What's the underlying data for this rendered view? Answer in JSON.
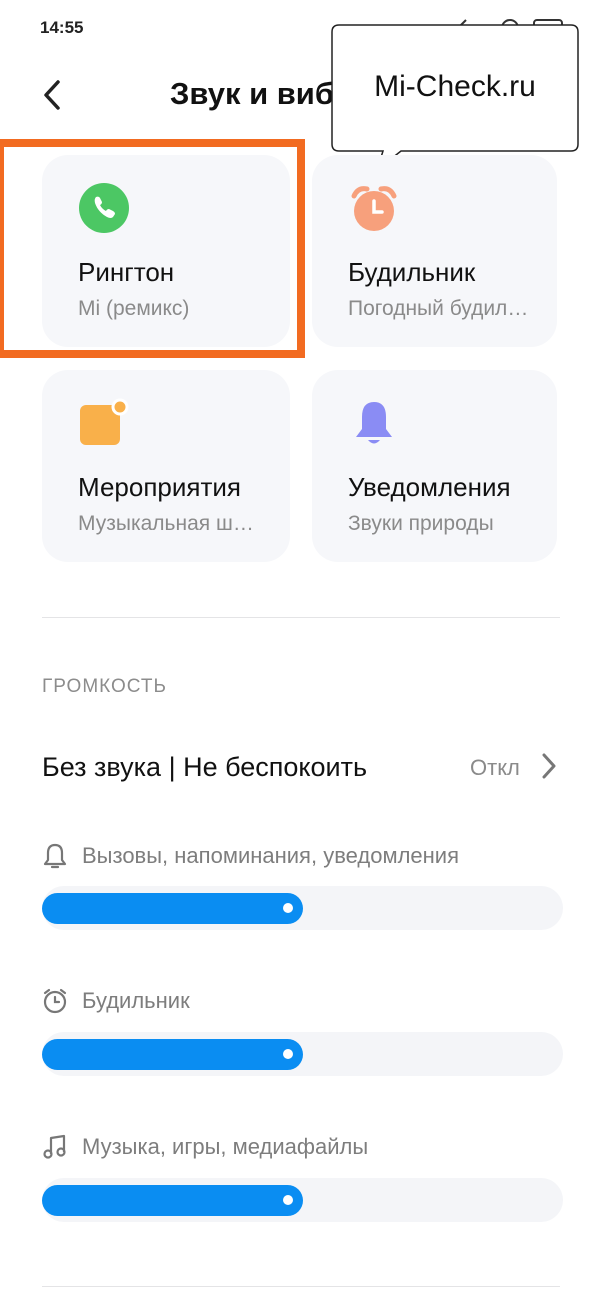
{
  "status_bar": {
    "time": "14:55"
  },
  "header": {
    "title": "Звук и вибрация",
    "tooltip_text": "Mi-Check.ru"
  },
  "cards": [
    {
      "title": "Рингтон",
      "subtitle": "Mi (ремикс)",
      "icon": "phone-icon",
      "color": "#4cc764"
    },
    {
      "title": "Будильник",
      "subtitle": "Погодный будильник",
      "icon": "alarm-clock-icon",
      "color": "#f7a07c"
    },
    {
      "title": "Мероприятия",
      "subtitle": "Музыкальная шкатулка",
      "icon": "calendar-event-icon",
      "color": "#f9b04a"
    },
    {
      "title": "Уведомления",
      "subtitle": "Звуки природы",
      "icon": "bell-icon",
      "color": "#8a8cf4"
    }
  ],
  "volume": {
    "section_title": "ГРОМКОСТЬ",
    "dnd": {
      "label": "Без звука | Не беспокоить",
      "value": "Откл"
    },
    "sliders": [
      {
        "label": "Вызовы, напоминания, уведомления",
        "icon": "bell-outline-icon",
        "level": 0.5
      },
      {
        "label": "Будильник",
        "icon": "alarm-outline-icon",
        "level": 0.5
      },
      {
        "label": "Музыка, игры, медиафайлы",
        "icon": "music-note-icon",
        "level": 0.5
      }
    ]
  },
  "colors": {
    "accent": "#0a8df2",
    "highlight": "#f26b21"
  }
}
